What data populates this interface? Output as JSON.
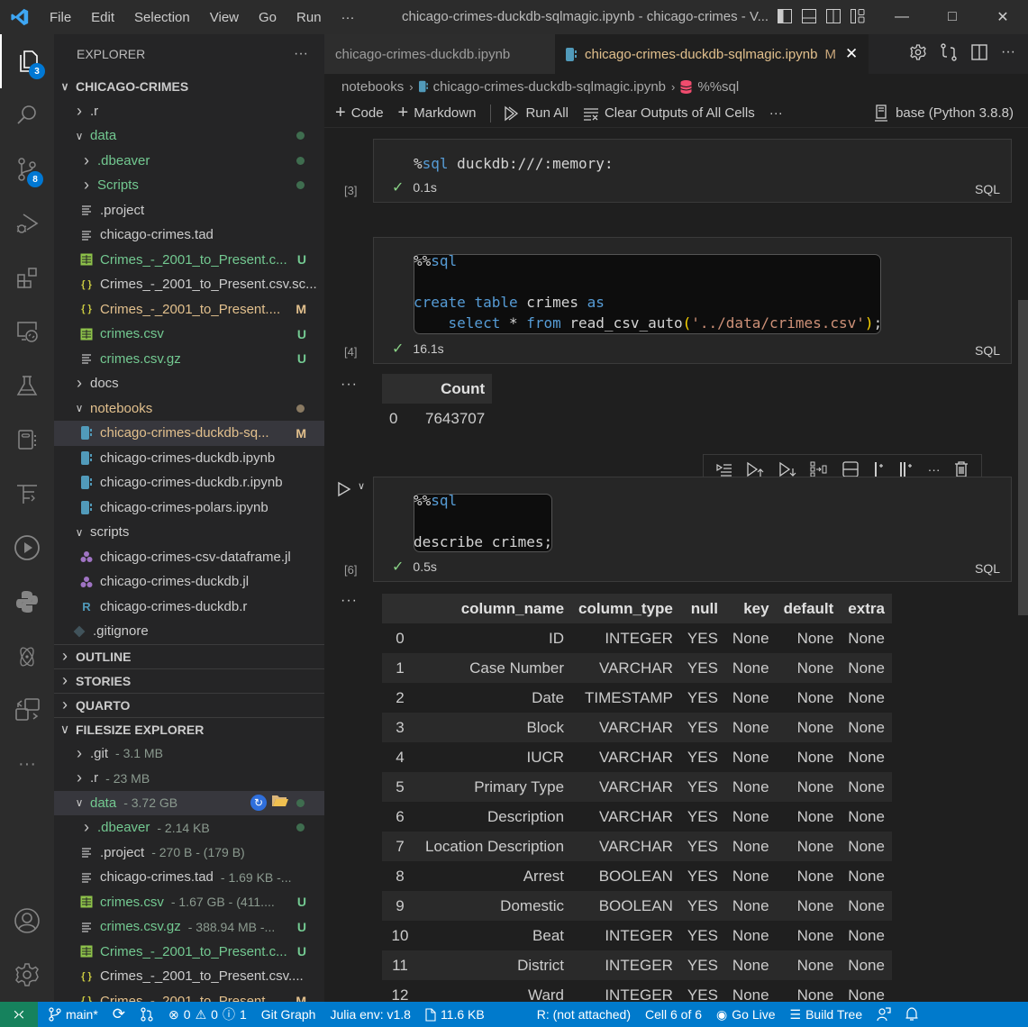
{
  "window": {
    "title": "chicago-crimes-duckdb-sqlmagic.ipynb - chicago-crimes - V...",
    "menu": [
      "File",
      "Edit",
      "Selection",
      "View",
      "Go",
      "Run",
      "···"
    ]
  },
  "activity_bar": {
    "items": [
      {
        "name": "explorer",
        "badge": "3"
      },
      {
        "name": "search"
      },
      {
        "name": "source-control",
        "badge": "8"
      },
      {
        "name": "run-debug"
      },
      {
        "name": "extensions"
      },
      {
        "name": "remote-explorer"
      },
      {
        "name": "testing"
      },
      {
        "name": "jupyter"
      },
      {
        "name": "timeline"
      },
      {
        "name": "run"
      },
      {
        "name": "python"
      },
      {
        "name": "react-devtools"
      },
      {
        "name": "remote-sync"
      },
      {
        "name": "more"
      },
      {
        "name": "accounts"
      },
      {
        "name": "manage"
      }
    ]
  },
  "sidebar": {
    "title": "EXPLORER",
    "more": "···",
    "root": "CHICAGO-CRIMES",
    "tree": [
      {
        "label": ".r",
        "depth": 1,
        "type": "folder",
        "expanded": false,
        "color": "plain"
      },
      {
        "label": "data",
        "depth": 1,
        "type": "folder",
        "expanded": true,
        "color": "green",
        "dot": true
      },
      {
        "label": ".dbeaver",
        "depth": 2,
        "type": "folder",
        "expanded": false,
        "color": "green",
        "dot": true
      },
      {
        "label": "Scripts",
        "depth": 2,
        "type": "folder",
        "expanded": false,
        "color": "green",
        "dot": true
      },
      {
        "label": ".project",
        "depth": 2,
        "type": "text",
        "color": "plain"
      },
      {
        "label": "chicago-crimes.tad",
        "depth": 2,
        "type": "text",
        "color": "plain"
      },
      {
        "label": "Crimes_-_2001_to_Present.c...",
        "depth": 2,
        "type": "csv",
        "color": "green",
        "deco": "U"
      },
      {
        "label": "Crimes_-_2001_to_Present.csv.sc...",
        "depth": 2,
        "type": "json",
        "color": "plain"
      },
      {
        "label": "Crimes_-_2001_to_Present....",
        "depth": 2,
        "type": "json",
        "color": "mod",
        "deco": "M"
      },
      {
        "label": "crimes.csv",
        "depth": 2,
        "type": "csv",
        "color": "green",
        "deco": "U"
      },
      {
        "label": "crimes.csv.gz",
        "depth": 2,
        "type": "text",
        "color": "green",
        "deco": "U"
      },
      {
        "label": "docs",
        "depth": 1,
        "type": "folder",
        "expanded": false,
        "color": "plain"
      },
      {
        "label": "notebooks",
        "depth": 1,
        "type": "folder",
        "expanded": true,
        "color": "mod",
        "dot": true,
        "dotcolor": "#8a7a62"
      },
      {
        "label": "chicago-crimes-duckdb-sq...",
        "depth": 2,
        "type": "notebook",
        "color": "mod",
        "deco": "M",
        "selected": true
      },
      {
        "label": "chicago-crimes-duckdb.ipynb",
        "depth": 2,
        "type": "notebook",
        "color": "plain"
      },
      {
        "label": "chicago-crimes-duckdb.r.ipynb",
        "depth": 2,
        "type": "notebook",
        "color": "plain"
      },
      {
        "label": "chicago-crimes-polars.ipynb",
        "depth": 2,
        "type": "notebook",
        "color": "plain"
      },
      {
        "label": "scripts",
        "depth": 1,
        "type": "folder",
        "expanded": true,
        "color": "plain"
      },
      {
        "label": "chicago-crimes-csv-dataframe.jl",
        "depth": 2,
        "type": "julia",
        "color": "plain"
      },
      {
        "label": "chicago-crimes-duckdb.jl",
        "depth": 2,
        "type": "julia",
        "color": "plain"
      },
      {
        "label": "chicago-crimes-duckdb.r",
        "depth": 2,
        "type": "r",
        "color": "plain"
      },
      {
        "label": ".gitignore",
        "depth": 1,
        "type": "git",
        "color": "plain"
      }
    ],
    "sections": [
      "OUTLINE",
      "STORIES",
      "QUARTO"
    ],
    "filesize_explorer": {
      "title": "FILESIZE EXPLORER",
      "tree": [
        {
          "label": ".git",
          "size": "- 3.1 MB",
          "depth": 1,
          "type": "folder",
          "expanded": false,
          "color": "plain"
        },
        {
          "label": ".r",
          "size": "- 23 MB",
          "depth": 1,
          "type": "folder",
          "expanded": false,
          "color": "plain"
        },
        {
          "label": "data",
          "size": "- 3.72 GB",
          "depth": 1,
          "type": "folder",
          "expanded": true,
          "color": "green",
          "dot": true,
          "selected": true,
          "actions": true
        },
        {
          "label": ".dbeaver",
          "size": "- 2.14 KB",
          "depth": 2,
          "type": "folder",
          "expanded": false,
          "color": "green",
          "dot": true
        },
        {
          "label": ".project",
          "size": "- 270 B - (179 B)",
          "depth": 2,
          "type": "text",
          "color": "plain"
        },
        {
          "label": "chicago-crimes.tad",
          "size": "- 1.69 KB -...",
          "depth": 2,
          "type": "text",
          "color": "plain"
        },
        {
          "label": "crimes.csv",
          "size": "- 1.67 GB - (411....",
          "depth": 2,
          "type": "csv",
          "color": "green",
          "deco": "U"
        },
        {
          "label": "crimes.csv.gz",
          "size": "- 388.94 MB -...",
          "depth": 2,
          "type": "text",
          "color": "green",
          "deco": "U"
        },
        {
          "label": "Crimes_-_2001_to_Present.c...",
          "size": "",
          "depth": 2,
          "type": "csv",
          "color": "green",
          "deco": "U"
        },
        {
          "label": "Crimes_-_2001_to_Present.csv....",
          "size": "",
          "depth": 2,
          "type": "json",
          "color": "plain"
        },
        {
          "label": "Crimes_-_2001_to_Present...",
          "size": "",
          "depth": 2,
          "type": "json",
          "color": "mod",
          "deco": "M"
        }
      ]
    }
  },
  "editor": {
    "tabs": [
      {
        "label": "chicago-crimes-duckdb.ipynb",
        "active": false
      },
      {
        "label": "chicago-crimes-duckdb-sqlmagic.ipynb",
        "active": true,
        "deco": "M"
      }
    ],
    "breadcrumb": [
      "notebooks",
      "chicago-crimes-duckdb-sqlmagic.ipynb",
      "%%sql"
    ],
    "toolbar": {
      "code": "Code",
      "markdown": "Markdown",
      "run_all": "Run All",
      "clear_outputs": "Clear Outputs of All Cells",
      "more": "···",
      "kernel": "base (Python 3.8.8)"
    },
    "cells": [
      {
        "exec": "[3]",
        "time": "0.1s",
        "lang": "SQL",
        "code": {
          "magic": "%",
          "kw": "sql",
          "rest": " duckdb:///:memory:"
        }
      },
      {
        "exec": "[4]",
        "time": "16.1s",
        "lang": "SQL",
        "code": {
          "line1_magic": "%%",
          "line1_kw": "sql",
          "line3_kw1": "create",
          "line3_kw2": "table",
          "line3_ident": " crimes ",
          "line3_kw3": "as",
          "line4_kw1": "select",
          "line4_star": " * ",
          "line4_kw2": "from",
          "line4_fn": " read_csv_auto",
          "line4_open": "(",
          "line4_str": "'../data/crimes.csv'",
          "line4_close": ")",
          "line4_end": ";"
        },
        "output": {
          "columns": [
            "Count"
          ],
          "rows": [
            {
              "index": "0",
              "values": [
                "7643707"
              ]
            }
          ]
        }
      },
      {
        "exec": "[6]",
        "time": "0.5s",
        "lang": "SQL",
        "code": {
          "line1_magic": "%%",
          "line1_kw": "sql",
          "line3": "describe crimes;"
        },
        "output": {
          "columns": [
            "column_name",
            "column_type",
            "null",
            "key",
            "default",
            "extra"
          ],
          "rows": [
            {
              "index": "0",
              "values": [
                "ID",
                "INTEGER",
                "YES",
                "None",
                "None",
                "None"
              ]
            },
            {
              "index": "1",
              "values": [
                "Case Number",
                "VARCHAR",
                "YES",
                "None",
                "None",
                "None"
              ]
            },
            {
              "index": "2",
              "values": [
                "Date",
                "TIMESTAMP",
                "YES",
                "None",
                "None",
                "None"
              ]
            },
            {
              "index": "3",
              "values": [
                "Block",
                "VARCHAR",
                "YES",
                "None",
                "None",
                "None"
              ]
            },
            {
              "index": "4",
              "values": [
                "IUCR",
                "VARCHAR",
                "YES",
                "None",
                "None",
                "None"
              ]
            },
            {
              "index": "5",
              "values": [
                "Primary Type",
                "VARCHAR",
                "YES",
                "None",
                "None",
                "None"
              ]
            },
            {
              "index": "6",
              "values": [
                "Description",
                "VARCHAR",
                "YES",
                "None",
                "None",
                "None"
              ]
            },
            {
              "index": "7",
              "values": [
                "Location Description",
                "VARCHAR",
                "YES",
                "None",
                "None",
                "None"
              ]
            },
            {
              "index": "8",
              "values": [
                "Arrest",
                "BOOLEAN",
                "YES",
                "None",
                "None",
                "None"
              ]
            },
            {
              "index": "9",
              "values": [
                "Domestic",
                "BOOLEAN",
                "YES",
                "None",
                "None",
                "None"
              ]
            },
            {
              "index": "10",
              "values": [
                "Beat",
                "INTEGER",
                "YES",
                "None",
                "None",
                "None"
              ]
            },
            {
              "index": "11",
              "values": [
                "District",
                "INTEGER",
                "YES",
                "None",
                "None",
                "None"
              ]
            },
            {
              "index": "12",
              "values": [
                "Ward",
                "INTEGER",
                "YES",
                "None",
                "None",
                "None"
              ]
            }
          ]
        }
      }
    ],
    "output_more": "···"
  },
  "statusbar": {
    "branch": "main*",
    "errors": "0",
    "warnings": "0",
    "info": "1",
    "git_graph": "Git Graph",
    "julia": "Julia env: v1.8",
    "filesize": "11.6 KB",
    "r_status": "R: (not attached)",
    "cell": "Cell 6 of 6",
    "go_live": "Go Live",
    "build_tree": "Build Tree"
  },
  "colors": {
    "accent": "#007acc",
    "remote": "#16825d",
    "git_untracked": "#73c991",
    "git_modified": "#e2c08d",
    "badge": "#0078d4"
  }
}
